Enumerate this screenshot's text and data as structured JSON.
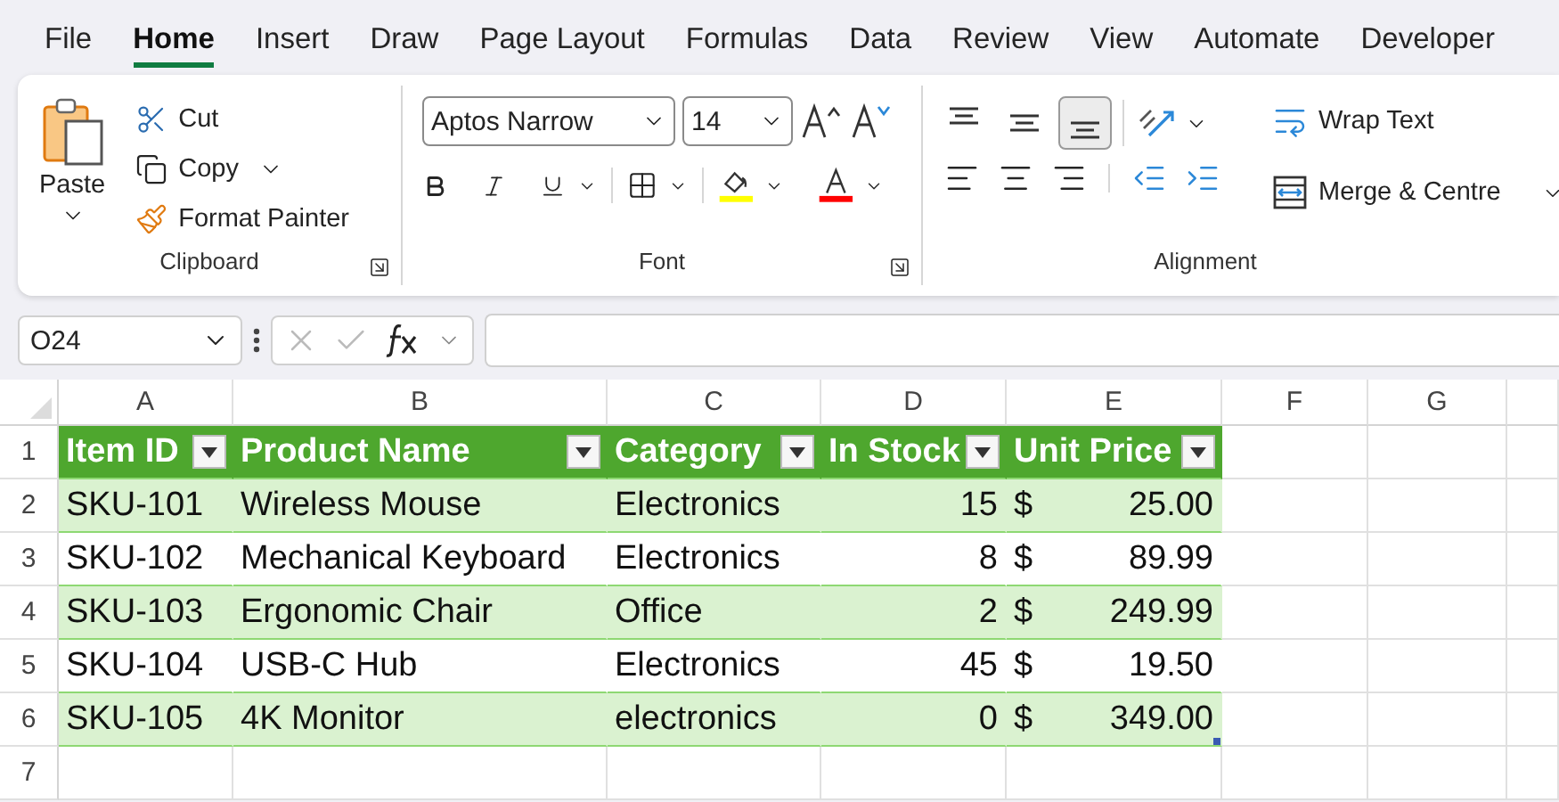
{
  "menu_tabs": [
    {
      "label": "File",
      "selected": false
    },
    {
      "label": "Home",
      "selected": true
    },
    {
      "label": "Insert",
      "selected": false
    },
    {
      "label": "Draw",
      "selected": false
    },
    {
      "label": "Page Layout",
      "selected": false
    },
    {
      "label": "Formulas",
      "selected": false
    },
    {
      "label": "Data",
      "selected": false
    },
    {
      "label": "Review",
      "selected": false
    },
    {
      "label": "View",
      "selected": false
    },
    {
      "label": "Automate",
      "selected": false
    },
    {
      "label": "Developer",
      "selected": false
    }
  ],
  "clipboard": {
    "paste": "Paste",
    "cut": "Cut",
    "copy": "Copy",
    "format_painter": "Format Painter",
    "group_label": "Clipboard"
  },
  "font": {
    "font_name": "Aptos Narrow",
    "font_size": "14",
    "group_label": "Font",
    "color_buttons": [
      {
        "kind": "fill",
        "color": "#ffff00"
      },
      {
        "kind": "text",
        "color": "#ff0000"
      }
    ]
  },
  "alignment": {
    "vertical_buttons": [
      {
        "kind": "top",
        "selected": false
      },
      {
        "kind": "middle",
        "selected": false
      },
      {
        "kind": "bottom",
        "selected": true
      }
    ],
    "wrap_text": "Wrap Text",
    "merge": "Merge & Centre",
    "group_label": "Alignment"
  },
  "name_box": "O24",
  "grid": {
    "columns": [
      "A",
      "B",
      "C",
      "D",
      "E",
      "F",
      "G"
    ],
    "row_numbers": [
      "1",
      "2",
      "3",
      "4",
      "5",
      "6",
      "7"
    ]
  },
  "table": {
    "headers": [
      "Item ID",
      "Product Name",
      "Category",
      "In Stock",
      "Unit Price"
    ],
    "rows": [
      {
        "item_id": "SKU-101",
        "product_name": "Wireless Mouse",
        "category": "Electronics",
        "in_stock": "15",
        "currency": "$",
        "unit_price": "25.00"
      },
      {
        "item_id": "SKU-102",
        "product_name": "Mechanical Keyboard",
        "category": "Electronics",
        "in_stock": "8",
        "currency": "$",
        "unit_price": "89.99"
      },
      {
        "item_id": "SKU-103",
        "product_name": "Ergonomic Chair",
        "category": "Office",
        "in_stock": "2",
        "currency": "$",
        "unit_price": "249.99"
      },
      {
        "item_id": "SKU-104",
        "product_name": "USB-C Hub",
        "category": "Electronics",
        "in_stock": "45",
        "currency": "$",
        "unit_price": "19.50"
      },
      {
        "item_id": "SKU-105",
        "product_name": "4K Monitor",
        "category": "electronics",
        "in_stock": "0",
        "currency": "$",
        "unit_price": "349.00"
      }
    ]
  }
}
